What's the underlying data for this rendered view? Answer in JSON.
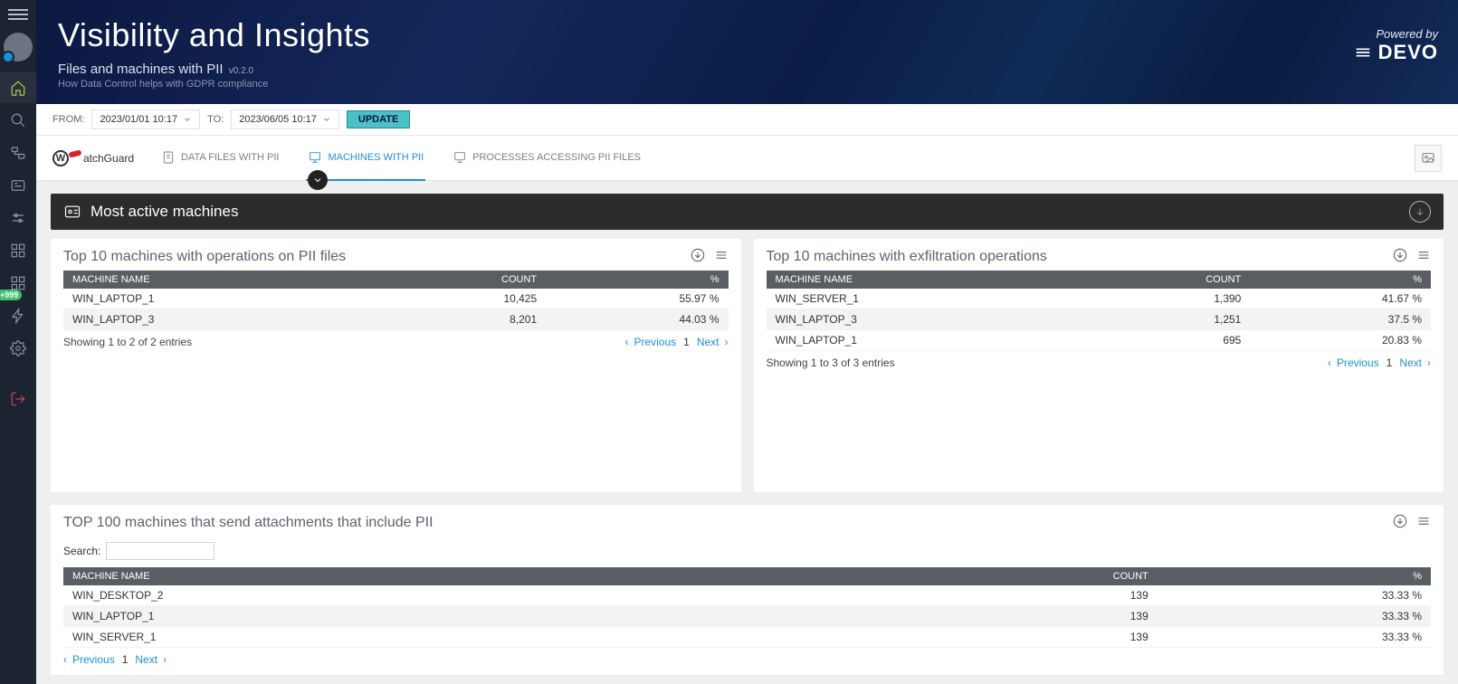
{
  "banner": {
    "title": "Visibility and Insights",
    "subtitle": "Files and machines with PII",
    "version": "v0.2.0",
    "description": "How Data Control helps with GDPR compliance",
    "powered_label": "Powered by",
    "powered_brand": "DEVO"
  },
  "sidebar": {
    "badge": "+999"
  },
  "filter": {
    "from_label": "FROM:",
    "from_value": "2023/01/01 10:17",
    "to_label": "TO:",
    "to_value": "2023/06/05 10:17",
    "update": "UPDATE"
  },
  "tabs": {
    "brand": "WatchGuard",
    "items": [
      {
        "label": "DATA FILES WITH PII",
        "active": false
      },
      {
        "label": "MACHINES WITH PII",
        "active": true
      },
      {
        "label": "PROCESSES ACCESSING PII FILES",
        "active": false
      }
    ]
  },
  "section": {
    "title": "Most active machines"
  },
  "panel1": {
    "title": "Top 10 machines with operations on PII files",
    "columns": {
      "c0": "MACHINE NAME",
      "c1": "COUNT",
      "c2": "%"
    },
    "rows": [
      {
        "name": "WIN_LAPTOP_1",
        "count": "10,425",
        "pct": "55.97 %"
      },
      {
        "name": "WIN_LAPTOP_3",
        "count": "8,201",
        "pct": "44.03 %"
      }
    ],
    "info": "Showing 1 to 2 of 2 entries",
    "pager": {
      "prev": "Previous",
      "page": "1",
      "next": "Next"
    }
  },
  "panel2": {
    "title": "Top 10 machines with exfiltration operations",
    "columns": {
      "c0": "MACHINE NAME",
      "c1": "COUNT",
      "c2": "%"
    },
    "rows": [
      {
        "name": "WIN_SERVER_1",
        "count": "1,390",
        "pct": "41.67 %"
      },
      {
        "name": "WIN_LAPTOP_3",
        "count": "1,251",
        "pct": "37.5 %"
      },
      {
        "name": "WIN_LAPTOP_1",
        "count": "695",
        "pct": "20.83 %"
      }
    ],
    "info": "Showing 1 to 3 of 3 entries",
    "pager": {
      "prev": "Previous",
      "page": "1",
      "next": "Next"
    }
  },
  "panel3": {
    "title": "TOP 100 machines that send attachments that include PII",
    "search_label": "Search:",
    "columns": {
      "c0": "MACHINE NAME",
      "c1": "COUNT",
      "c2": "%"
    },
    "rows": [
      {
        "name": "WIN_DESKTOP_2",
        "count": "139",
        "pct": "33.33 %"
      },
      {
        "name": "WIN_LAPTOP_1",
        "count": "139",
        "pct": "33.33 %"
      },
      {
        "name": "WIN_SERVER_1",
        "count": "139",
        "pct": "33.33 %"
      }
    ],
    "pager": {
      "prev": "Previous",
      "page": "1",
      "next": "Next"
    }
  }
}
